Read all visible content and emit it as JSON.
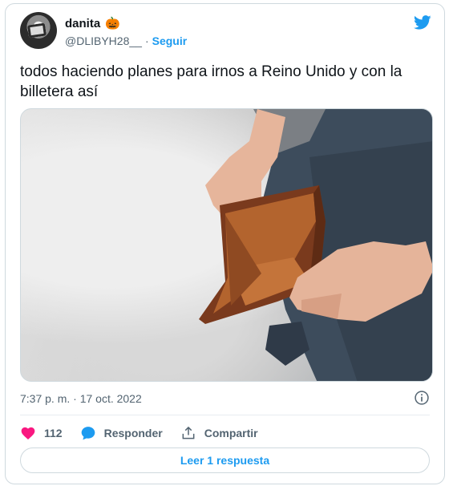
{
  "user": {
    "name": "danita",
    "emoji": "🎃",
    "handle": "@DLIBYH28__",
    "separator": "·",
    "follow_label": "Seguir"
  },
  "tweet": {
    "text": "todos haciendo planes para irnos a Reino Unido y con la billetera así",
    "timestamp": "7:37 p. m. · 17 oct. 2022"
  },
  "actions": {
    "likes_count": "112",
    "reply_label": "Responder",
    "share_label": "Compartir"
  },
  "read_reply_label": "Leer 1 respuesta",
  "colors": {
    "twitter_blue": "#1d9bf0",
    "like_pink": "#f91880",
    "text_primary": "#0f1419",
    "text_secondary": "#536471",
    "border": "#cfd9de"
  },
  "icons": [
    "twitter-bird-icon",
    "info-icon",
    "heart-icon",
    "reply-bubble-icon",
    "share-icon"
  ]
}
